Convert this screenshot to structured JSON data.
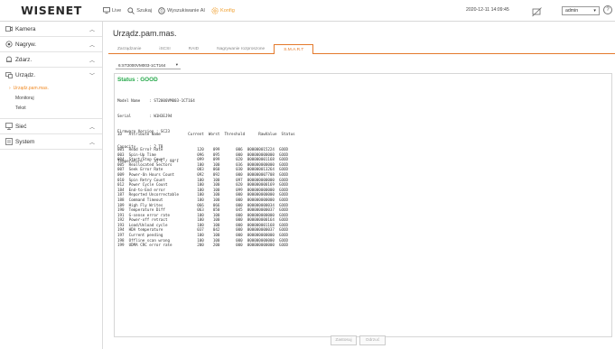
{
  "header": {
    "logo": "WISENET",
    "nav": [
      {
        "label": "Live",
        "icon": "monitor-icon",
        "active": false
      },
      {
        "label": "Szukaj",
        "icon": "search-icon",
        "active": false
      },
      {
        "label": "Wyszukiwanie AI",
        "icon": "ai-search-icon",
        "active": false
      },
      {
        "label": "Konfig",
        "icon": "gear-icon",
        "active": true
      }
    ],
    "datetime": "2020-12-11 14:09:45",
    "user": "admin",
    "help": "?"
  },
  "sidebar": {
    "groups": [
      {
        "label": "Kamera",
        "icon": "camera-icon",
        "expanded": false
      },
      {
        "label": "Nagryw.",
        "icon": "record-icon",
        "expanded": false
      },
      {
        "label": "Zdarz.",
        "icon": "bell-icon",
        "expanded": false
      },
      {
        "label": "Urządz.",
        "icon": "device-icon",
        "expanded": true,
        "items": [
          {
            "label": "Urządz.pam.mas.",
            "active": true
          },
          {
            "label": "Monitoruj",
            "active": false
          },
          {
            "label": "Tekst",
            "active": false
          }
        ]
      },
      {
        "label": "Sieć",
        "icon": "network-icon",
        "expanded": false
      },
      {
        "label": "System",
        "icon": "system-icon",
        "expanded": false
      }
    ]
  },
  "main": {
    "title": "Urządz.pam.mas.",
    "tabs": [
      {
        "label": "Zarządzanie",
        "active": false
      },
      {
        "label": "iSCSI",
        "active": false
      },
      {
        "label": "RAID",
        "active": false
      },
      {
        "label": "Nagrywanie rozproszone",
        "active": false
      },
      {
        "label": "S.M.A.R.T",
        "active": true
      }
    ],
    "disk_select": "6:ST2000VM003-1CT164",
    "status": "Status : GOOD",
    "info": [
      "Model Name    : ST2000VM003-1CT164",
      "Serial        : W1H3EJ94",
      "Firmware Version : SC23",
      "Capacity      : 2 TB",
      "Temperature   : 37°C / 98°F"
    ],
    "table_header": "ID   Attribute Name            Current  Worst  Threshold      RawValue  Status",
    "table_rows": [
      "001  Read Error Rate               120    099       006  000000015224  GOOD",
      "003  Spin-Up Time                  096    095       000  000000000000  GOOD",
      "004  Start/Stop Count              099    099       020  000000001168  GOOD",
      "005  Reallocated Sectors           100    100       036  000000000000  GOOD",
      "007  Seek Error Rate               083    060       030  000000013264  GOOD",
      "009  Power-On Hours Count          092    092       000  000000007708  GOOD",
      "010  Spin Retry Count              100    100       097  000000000000  GOOD",
      "012  Power Cycle Count             100    100       020  000000000169  GOOD",
      "184  End-to-End error              100    100       099  000000000000  GOOD",
      "187  Reported Uncorrectable        100    100       000  000000000000  GOOD",
      "188  Command Timeout               100    100       000  000000000000  GOOD",
      "189  High Fly Writes               066    066       000  000000000034  GOOD",
      "190  Temperature Diff              063    050       045  000000000037  GOOD",
      "191  G-sense error rate            100    100       000  000000000000  GOOD",
      "192  Power-off retract             100    100       000  000000000164  GOOD",
      "193  Load/Unload cycle             100    100       000  000000001168  GOOD",
      "194  HDA temperature               037    042       000  000000000037  GOOD",
      "197  Current pending               100    100       000  000000000000  GOOD",
      "198  Offline scan wrong            100    100       000  000000000000  GOOD",
      "199  UDMA CRC error rate           200    200       000  000000000000  GOOD"
    ],
    "buttons": {
      "apply": "Zastosuj",
      "cancel": "Odrzuć"
    }
  },
  "colors": {
    "accent": "#e47a2c",
    "status_good": "#25a84a"
  }
}
